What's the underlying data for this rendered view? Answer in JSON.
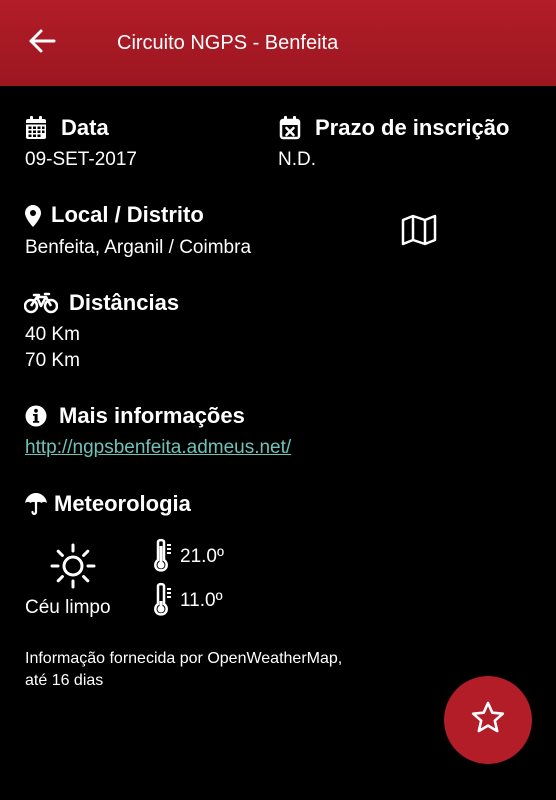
{
  "appbar": {
    "title": "Circuito NGPS - Benfeita",
    "back_icon": "arrow-left-icon"
  },
  "date": {
    "label": "Data",
    "value": "09-SET-2017",
    "icon": "calendar-icon"
  },
  "deadline": {
    "label": "Prazo de inscrição",
    "value": "N.D.",
    "icon": "calendar-x-icon"
  },
  "location": {
    "label": "Local / Distrito",
    "value": "Benfeita, Arganil / Coimbra",
    "icon": "map-pin-icon",
    "map_icon": "map-icon"
  },
  "distances": {
    "label": "Distâncias",
    "icon": "bicycle-icon",
    "items": [
      "40 Km",
      "70 Km"
    ]
  },
  "more_info": {
    "label": "Mais informações",
    "icon": "info-icon",
    "url": "http://ngpsbenfeita.admeus.net/"
  },
  "weather": {
    "label": "Meteorologia",
    "icon": "umbrella-icon",
    "condition_icon": "sun-icon",
    "condition": "Céu limpo",
    "max_temp": "21.0º",
    "min_temp": "11.0º",
    "attribution": "Informação fornecida por OpenWeatherMap,",
    "attribution_line2": "até 16 dias"
  },
  "fab": {
    "icon": "star-icon"
  },
  "colors": {
    "appbar": "#b21d28",
    "link": "#6fc2b8",
    "background": "#000000"
  }
}
